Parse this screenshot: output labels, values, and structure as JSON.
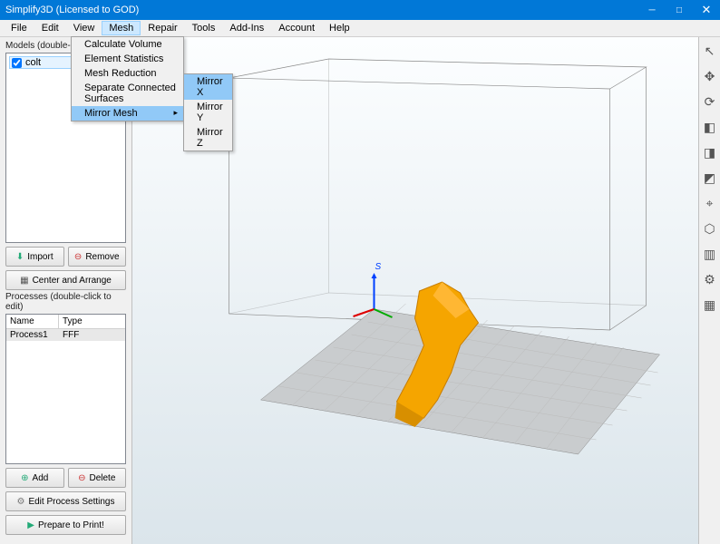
{
  "title": "Simplify3D (Licensed to GOD)",
  "menubar": [
    "File",
    "Edit",
    "View",
    "Mesh",
    "Repair",
    "Tools",
    "Add-Ins",
    "Account",
    "Help"
  ],
  "menubar_open_index": 3,
  "mesh_menu": [
    "Calculate Volume",
    "Element Statistics",
    "Mesh Reduction",
    "Separate Connected Surfaces",
    "Mirror Mesh"
  ],
  "mesh_menu_hover_index": 4,
  "mirror_submenu": [
    "Mirror X",
    "Mirror Y",
    "Mirror Z"
  ],
  "mirror_submenu_hover_index": 0,
  "models_panel": {
    "label": "Models (double-click",
    "items": [
      {
        "name": "colt",
        "checked": true
      }
    ],
    "import_label": "Import",
    "remove_label": "Remove",
    "center_label": "Center and Arrange"
  },
  "processes_panel": {
    "label": "Processes (double-click to edit)",
    "headers": [
      "Name",
      "Type"
    ],
    "rows": [
      {
        "name": "Process1",
        "type": "FFF"
      }
    ],
    "add_label": "Add",
    "delete_label": "Delete",
    "edit_label": "Edit Process Settings",
    "prepare_label": "Prepare to Print!"
  },
  "right_tools": [
    {
      "name": "cursor",
      "glyph": "↖"
    },
    {
      "name": "move",
      "glyph": "✥"
    },
    {
      "name": "rotate",
      "glyph": "⟳"
    },
    {
      "name": "cube-top",
      "glyph": "◧"
    },
    {
      "name": "cube-front",
      "glyph": "◨"
    },
    {
      "name": "cube-side",
      "glyph": "◩"
    },
    {
      "name": "axis",
      "glyph": "⌖"
    },
    {
      "name": "wireframe",
      "glyph": "⬡"
    },
    {
      "name": "book",
      "glyph": "▥"
    },
    {
      "name": "gear",
      "glyph": "⚙"
    },
    {
      "name": "table",
      "glyph": "▦"
    }
  ],
  "colors": {
    "accent": "#0178d7",
    "highlight": "#91c9f7",
    "model": "#f5a500"
  }
}
